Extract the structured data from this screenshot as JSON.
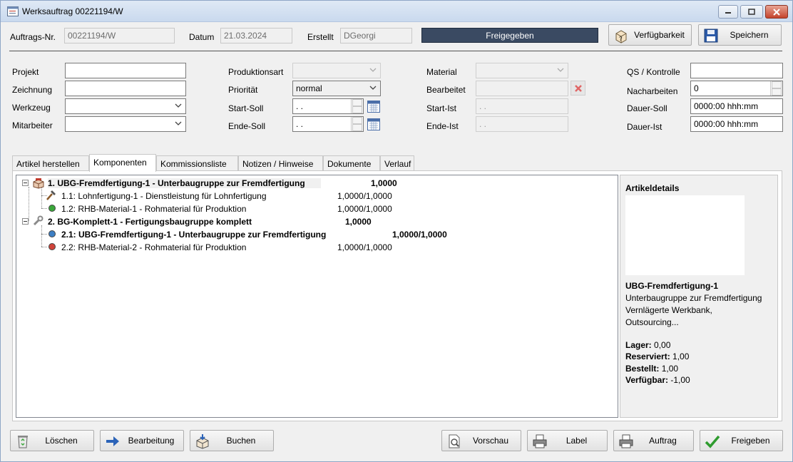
{
  "window": {
    "title": "Werksauftrag 00221194/W",
    "minimize_icon": "minimize-icon",
    "maximize_icon": "maximize-icon",
    "close_icon": "close-icon"
  },
  "header": {
    "order_no_label": "Auftrags-Nr.",
    "order_no_value": "00221194/W",
    "date_label": "Datum",
    "date_value": "21.03.2024",
    "created_label": "Erstellt",
    "created_value": "DGeorgi",
    "status_text": "Freigegeben",
    "availability_label": "Verfügbarkeit",
    "save_label": "Speichern"
  },
  "form": {
    "col1": [
      {
        "label": "Projekt",
        "value": ""
      },
      {
        "label": "Zeichnung",
        "value": ""
      },
      {
        "label": "Werkzeug",
        "value": ""
      },
      {
        "label": "Mitarbeiter",
        "value": ""
      }
    ],
    "col2": {
      "produktionsart_label": "Produktionsart",
      "produktionsart_value": "",
      "prioritaet_label": "Priorität",
      "prioritaet_value": "normal",
      "start_soll_label": "Start-Soll",
      "start_soll_value": " .  .",
      "ende_soll_label": "Ende-Soll",
      "ende_soll_value": " .  ."
    },
    "col3": {
      "material_label": "Material",
      "material_value": "",
      "bearbeitet_label": "Bearbeitet",
      "bearbeitet_value": "",
      "start_ist_label": "Start-Ist",
      "start_ist_value": " .  .",
      "ende_ist_label": "Ende-Ist",
      "ende_ist_value": " .  ."
    },
    "col4": {
      "qs_label": "QS / Kontrolle",
      "qs_value": "",
      "nacharbeiten_label": "Nacharbeiten",
      "nacharbeiten_value": "0",
      "dauer_soll_label": "Dauer-Soll",
      "dauer_soll_value": "0000:00 hhh:mm",
      "dauer_ist_label": "Dauer-Ist",
      "dauer_ist_value": "0000:00 hhh:mm"
    }
  },
  "tabs": [
    {
      "label": "Artikel herstellen"
    },
    {
      "label": "Komponenten"
    },
    {
      "label": "Kommissionsliste"
    },
    {
      "label": "Notizen / Hinweise"
    },
    {
      "label": "Dokumente"
    },
    {
      "label": "Verlauf"
    }
  ],
  "tree": [
    {
      "text": "1. UBG-Fremdfertigung-1 - Unterbaugruppe zur Fremdfertigung",
      "qty": "1,0000",
      "bold": true,
      "icon": "assembly-icon",
      "level": 0
    },
    {
      "text": "1.1: Lohnfertigung-1 - Dienstleistung für Lohnfertigung",
      "qty": "1,0000/1,0000",
      "bold": false,
      "icon": "hammer-icon",
      "level": 1
    },
    {
      "text": "1.2: RHB-Material-1 - Rohmaterial für Produktion",
      "qty": "1,0000/1,0000",
      "bold": false,
      "icon": "green-dot-icon",
      "level": 1
    },
    {
      "text": "2. BG-Komplett-1 - Fertigungsbaugruppe komplett",
      "qty": "1,0000",
      "bold": true,
      "icon": "wrench-icon",
      "level": 0
    },
    {
      "text": "2.1: UBG-Fremdfertigung-1 - Unterbaugruppe zur Fremdfertigung",
      "qty": "1,0000/1,0000",
      "bold": true,
      "icon": "blue-dot-icon",
      "level": 1
    },
    {
      "text": "2.2: RHB-Material-2 - Rohmaterial für Produktion",
      "qty": "1,0000/1,0000",
      "bold": false,
      "icon": "red-dot-icon",
      "level": 1
    }
  ],
  "details": {
    "header": "Artikeldetails",
    "name": "UBG-Fremdfertigung-1",
    "desc1": "Unterbaugruppe zur Fremdfertigung",
    "desc2": "Vernlägerte Werkbank,",
    "desc3": "Outsourcing...",
    "lager_label": "Lager:",
    "lager_value": "0,00",
    "reserviert_label": "Reserviert:",
    "reserviert_value": "1,00",
    "bestellt_label": "Bestellt:",
    "bestellt_value": "1,00",
    "verfuegbar_label": "Verfügbar:",
    "verfuegbar_value": "-1,00"
  },
  "footer": {
    "loeschen": "Löschen",
    "bearbeitung": "Bearbeitung",
    "buchen": "Buchen",
    "vorschau": "Vorschau",
    "label": "Label",
    "auftrag": "Auftrag",
    "freigeben": "Freigeben"
  },
  "colors": {
    "status_bg": "#3a4a62",
    "freigeben_check": "#2e9b2e"
  }
}
